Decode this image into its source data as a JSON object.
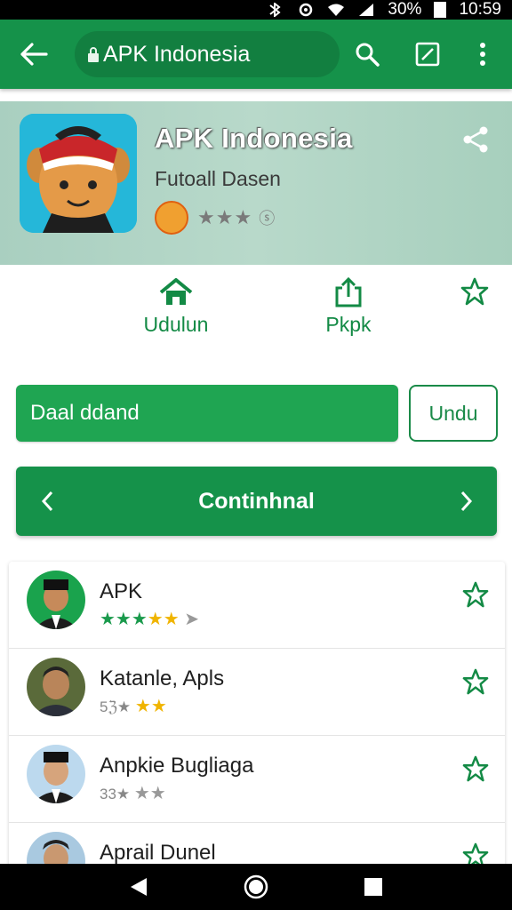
{
  "status_bar": {
    "battery_text": "30%",
    "time": "10:59"
  },
  "app_bar": {
    "url": "APK Indonesia"
  },
  "hero": {
    "title": "APK Indonesia",
    "subtitle": "Futoall Dasen",
    "rating_stars": "★★★"
  },
  "actions": [
    {
      "label": "Udulun",
      "icon": "home-icon"
    },
    {
      "label": "Pkpk",
      "icon": "share-upload-icon"
    },
    {
      "label": "",
      "icon": "star-outline-icon"
    }
  ],
  "buttons": {
    "primary": "Daal ddand",
    "secondary": "Undu"
  },
  "banner": {
    "label": "Continhnal"
  },
  "list": [
    {
      "name": "APK",
      "stars": "★★★★★"
    },
    {
      "name": "Katanle, Apls",
      "stars": "★★"
    },
    {
      "name": "Anpkie Bugliaga",
      "stars": "★★"
    },
    {
      "name": "Aprail Dunel",
      "stars": ""
    }
  ],
  "colors": {
    "primary_green": "#15924a",
    "button_green": "#1fa552",
    "star_gold": "#f0b400"
  }
}
